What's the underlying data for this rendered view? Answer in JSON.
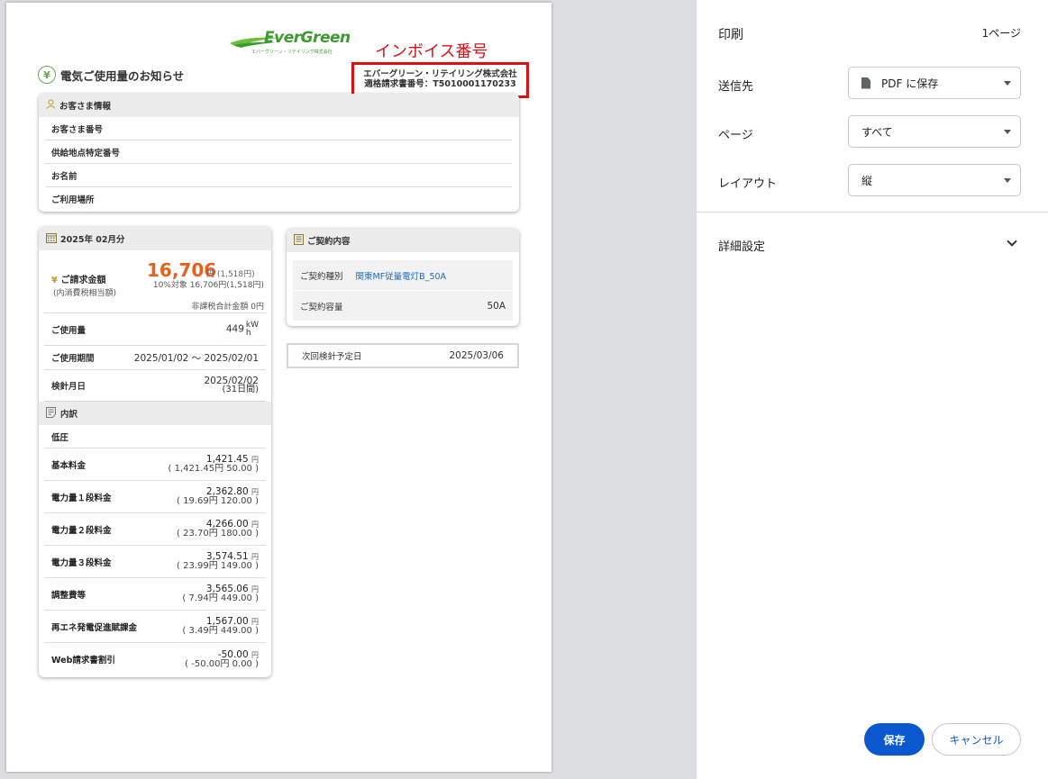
{
  "document": {
    "logo_text": "EverGreen",
    "logo_sub": "エバーグリーン・リテイリング株式会社",
    "invoice_label": "インボイス番号",
    "company_name": "エバーグリーン・リテイリング株式会社",
    "registration_number": "適格請求書番号：T5010001170233",
    "title": "電気ご使用量のお知らせ",
    "customer": {
      "header": "お客さま情報",
      "rows": [
        "お客さま番号",
        "供給地点特定番号",
        "お名前",
        "ご利用場所"
      ]
    },
    "billing": {
      "header": "2025年 02月分",
      "amount_label": "ご請求金額",
      "amount_sub_label": "(内消費税相当額)",
      "amount": "16,706",
      "amount_unit": "円 (1,518円)",
      "tax_target": "10%対象 16,706円(1,518円)",
      "tax_free": "非課税合計金額 0円",
      "usage_label": "ご使用量",
      "usage_value": "449",
      "usage_unit_top": "kW",
      "usage_unit_bottom": "h",
      "period_label": "ご使用期間",
      "period_value": "2025/01/02 ～ 2025/02/01",
      "meter_label": "検針月日",
      "meter_value": "2025/02/02",
      "meter_days": "(31日間)"
    },
    "breakdown": {
      "header": "内訳",
      "voltage": "低圧",
      "fees": [
        {
          "label": "基本料金",
          "amount": "1,421.45",
          "detail": "( 1,421.45円 50.00 )"
        },
        {
          "label": "電力量１段料金",
          "amount": "2,362.80",
          "detail": "( 19.69円 120.00 )"
        },
        {
          "label": "電力量２段料金",
          "amount": "4,266.00",
          "detail": "( 23.70円 180.00 )"
        },
        {
          "label": "電力量３段料金",
          "amount": "3,574.51",
          "detail": "( 23.99円 149.00 )"
        },
        {
          "label": "調整費等",
          "amount": "3,565.06",
          "detail": "( 7.94円 449.00 )"
        },
        {
          "label": "再エネ発電促進賦課金",
          "amount": "1,567.00",
          "detail": "( 3.49円 449.00 )"
        },
        {
          "label": "Web請求書割引",
          "amount": "-50.00",
          "detail": "( -50.00円 0.00 )"
        }
      ],
      "yen": "円"
    },
    "contract": {
      "header": "ご契約内容",
      "type_label": "ご契約種別",
      "type_value": "関東MF従量電灯B_50A",
      "capacity_label": "ご契約容量",
      "capacity_value": "50A"
    },
    "next_reading": {
      "label": "次回検針予定日",
      "value": "2025/03/06"
    }
  },
  "print_panel": {
    "title": "印刷",
    "page_count": "1ページ",
    "destination_label": "送信先",
    "destination_value": "PDF に保存",
    "pages_label": "ページ",
    "pages_value": "すべて",
    "layout_label": "レイアウト",
    "layout_value": "縦",
    "more_settings": "詳細設定",
    "save_button": "保存",
    "cancel_button": "キャンセル"
  },
  "colors": {
    "accent_blue": "#0b57d0",
    "amount_orange": "#e8601c",
    "invoice_red": "#d9131a",
    "logo_green": "#3c9a2f"
  }
}
